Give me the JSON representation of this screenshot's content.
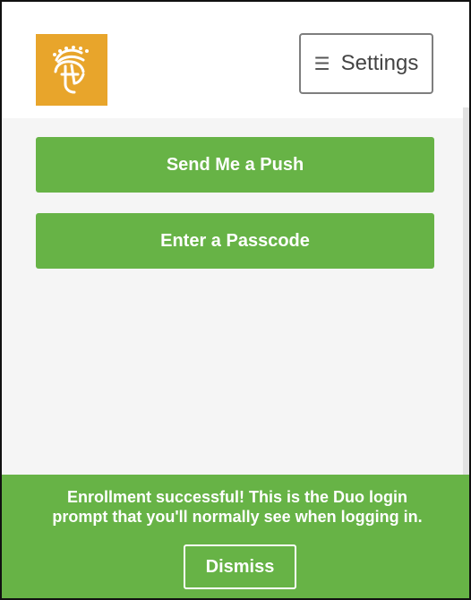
{
  "header": {
    "settings_label": "Settings",
    "settings_icon": "menu-icon",
    "logo_icon": "spartan-helmet-icon"
  },
  "main": {
    "push_label": "Send Me a Push",
    "passcode_label": "Enter a Passcode"
  },
  "banner": {
    "line1": "Enrollment successful! This is the Duo login",
    "line2": "prompt that you'll normally see when logging in.",
    "dismiss_label": "Dismiss"
  },
  "colors": {
    "accent_green": "#67b346",
    "logo_gold": "#e8a52b"
  }
}
